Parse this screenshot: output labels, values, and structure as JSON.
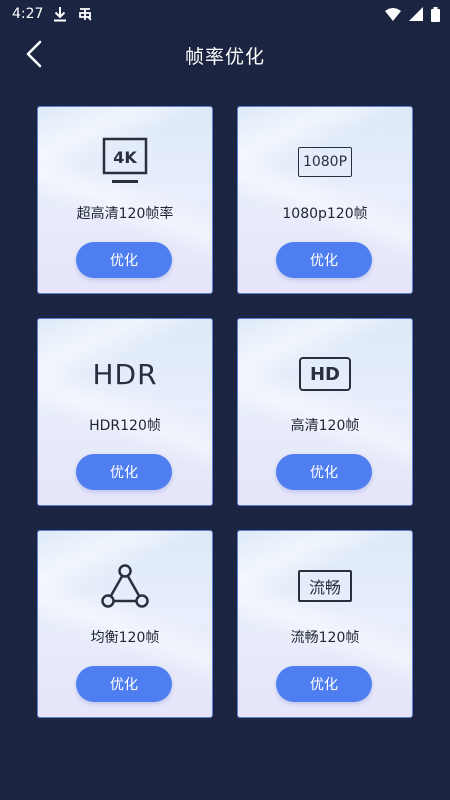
{
  "status_bar": {
    "time": "4:27",
    "icons": [
      "download-icon",
      "bug-icon",
      "wifi-icon",
      "signal-icon",
      "battery-icon"
    ]
  },
  "header": {
    "title": "帧率优化",
    "back_icon": "chevron-left-icon"
  },
  "colors": {
    "background": "#1b2440",
    "card_border": "#5f7fd6",
    "button": "#4f7ef0",
    "button_text": "#ffffff"
  },
  "cards": [
    {
      "icon": "4k-monitor-icon",
      "icon_text": "4K",
      "label": "超高清120帧率",
      "button": "优化"
    },
    {
      "icon": "1080p-icon",
      "icon_text": "1080P",
      "label": "1080p120帧",
      "button": "优化"
    },
    {
      "icon": "hdr-icon",
      "icon_text": "HDR",
      "label": "HDR120帧",
      "button": "优化"
    },
    {
      "icon": "hd-icon",
      "icon_text": "HD",
      "label": "高清120帧",
      "button": "优化"
    },
    {
      "icon": "balance-triangle-icon",
      "icon_text": "",
      "label": "均衡120帧",
      "button": "优化"
    },
    {
      "icon": "smooth-icon",
      "icon_text": "流畅",
      "label": "流畅120帧",
      "button": "优化"
    }
  ]
}
